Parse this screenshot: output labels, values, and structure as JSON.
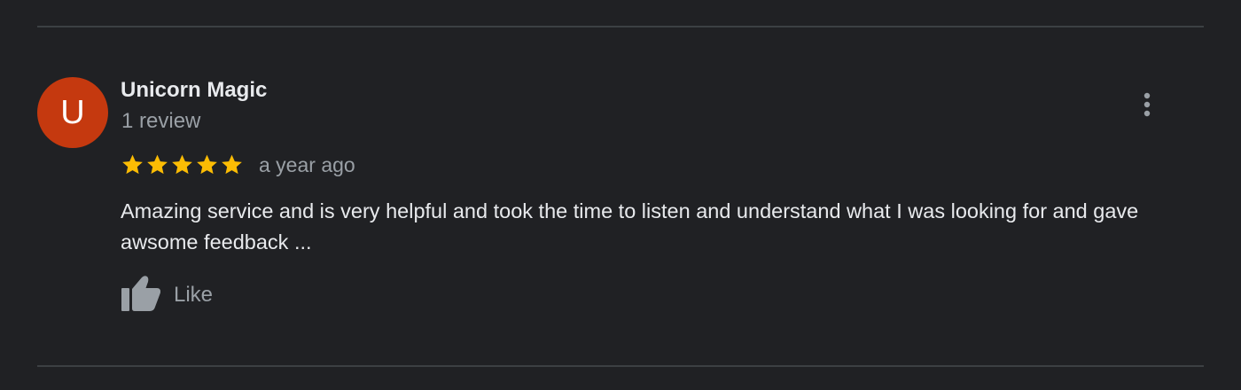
{
  "reviewer": {
    "avatar_letter": "U",
    "name": "Unicorn Magic",
    "review_count": "1 review"
  },
  "review": {
    "rating": 5,
    "max_rating": 5,
    "timestamp": "a year ago",
    "text": "Amazing service and is very helpful and took the time to listen and understand what I was looking for and gave awsome feedback ..."
  },
  "actions": {
    "like_label": "Like",
    "more_icon": "more-vert-icon",
    "like_icon": "thumbs-up-icon"
  },
  "colors": {
    "background": "#202124",
    "avatar": "#c5390f",
    "star": "#fbbc04",
    "primary_text": "#e8eaed",
    "secondary_text": "#9aa0a6"
  }
}
